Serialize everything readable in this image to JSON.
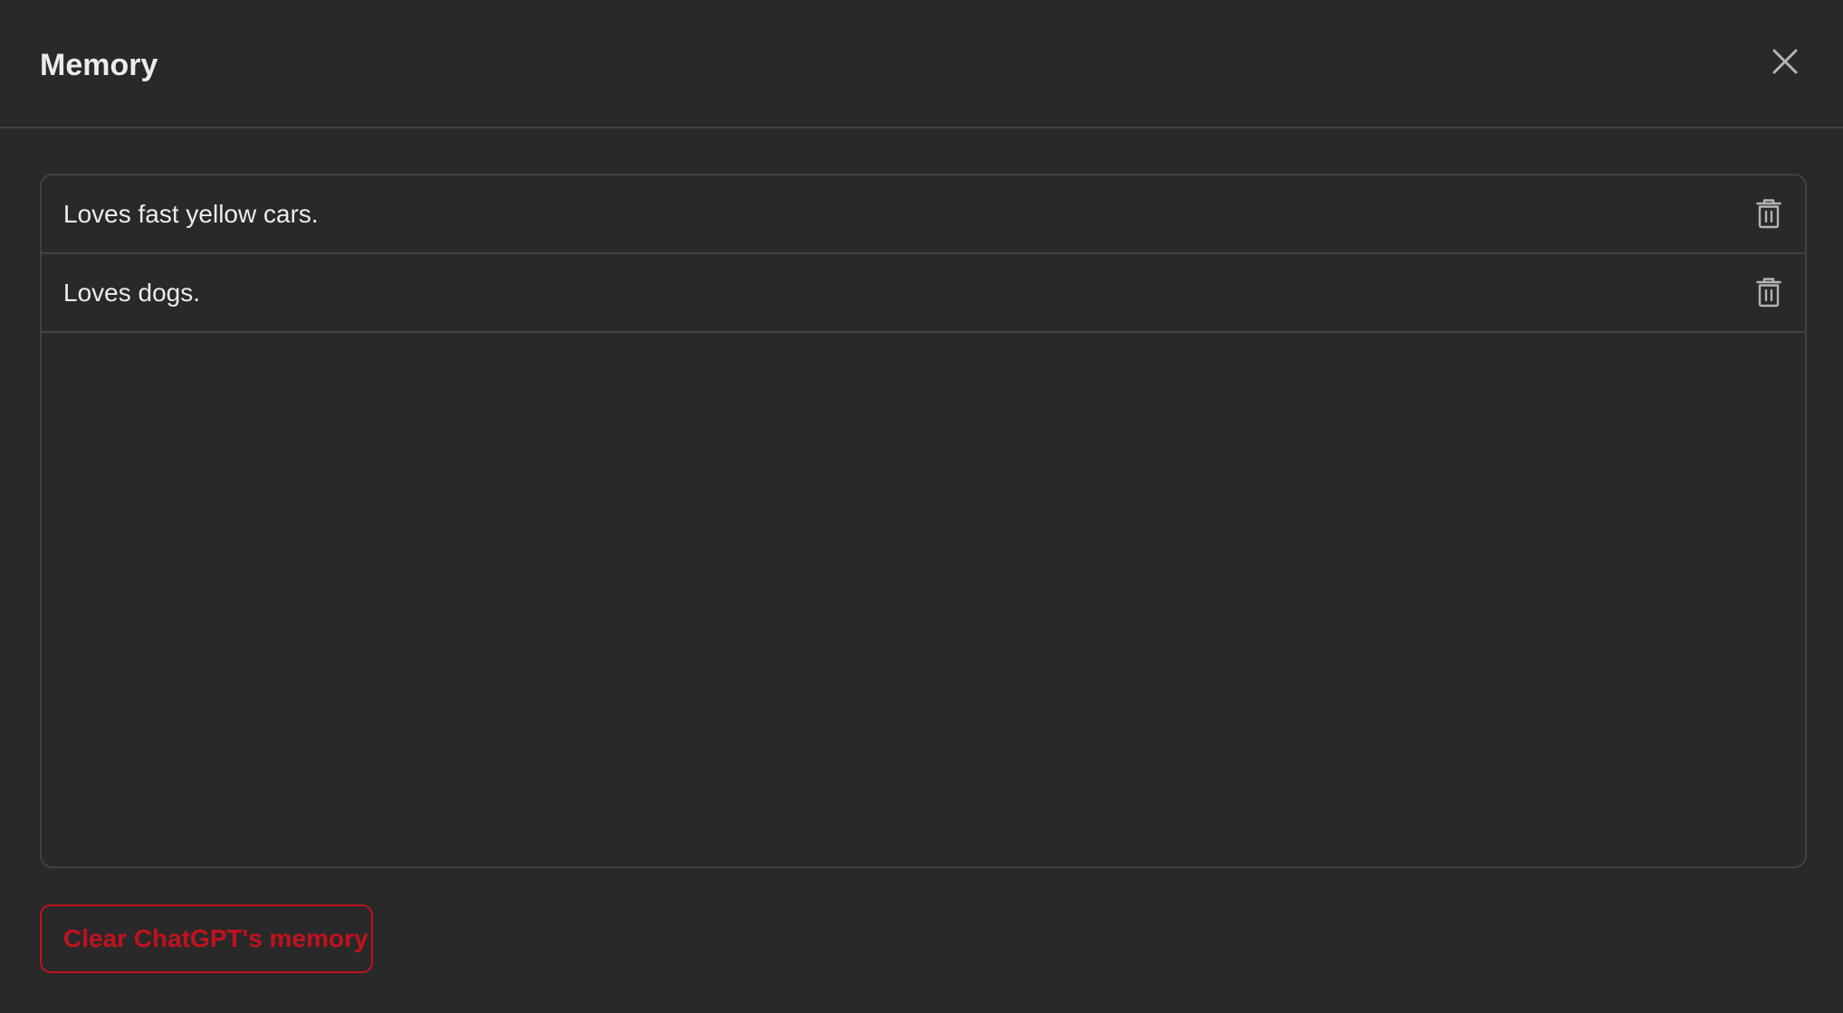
{
  "dialog": {
    "title": "Memory",
    "close_icon": "close-icon"
  },
  "memories": [
    {
      "text": "Loves fast yellow cars.",
      "delete_icon": "trash-icon"
    },
    {
      "text": "Loves dogs.",
      "delete_icon": "trash-icon"
    }
  ],
  "actions": {
    "clear_label": "Clear ChatGPT's memory"
  },
  "colors": {
    "background": "#292929",
    "border": "#424242",
    "text": "#ececec",
    "icon": "#b4b4b4",
    "danger": "#c1121f"
  }
}
